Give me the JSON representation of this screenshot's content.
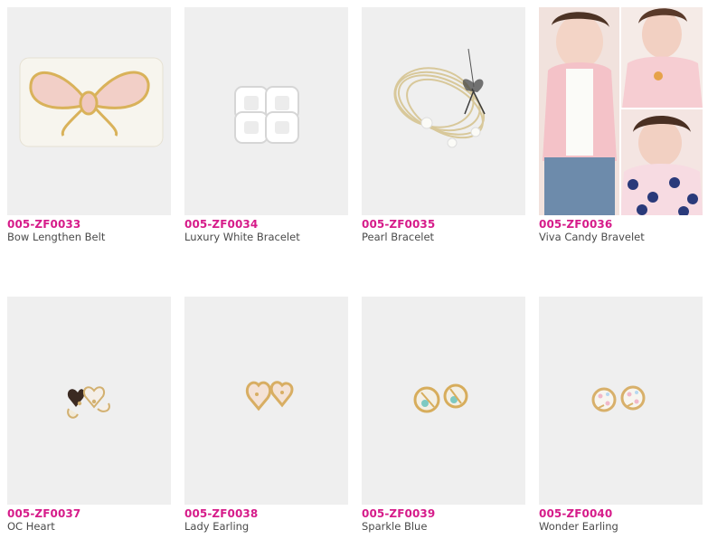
{
  "products": [
    {
      "code": "005-ZF0033",
      "name": "Bow Lengthen Belt",
      "image_icon": "bow-belt-icon"
    },
    {
      "code": "005-ZF0034",
      "name": "Luxury White Bracelet",
      "image_icon": "white-bracelet-icon"
    },
    {
      "code": "005-ZF0035",
      "name": "Pearl Bracelet",
      "image_icon": "pearl-bracelet-icon"
    },
    {
      "code": "005-ZF0036",
      "name": "Viva Candy Bravelet",
      "image_icon": "model-photo-collage-icon"
    },
    {
      "code": "005-ZF0037",
      "name": "OC Heart",
      "image_icon": "heart-earring-icon"
    },
    {
      "code": "005-ZF0038",
      "name": "Lady Earling",
      "image_icon": "lady-earring-icon"
    },
    {
      "code": "005-ZF0039",
      "name": "Sparkle Blue",
      "image_icon": "sparkle-blue-earring-icon"
    },
    {
      "code": "005-ZF0040",
      "name": "Wonder Earling",
      "image_icon": "wonder-earring-icon"
    }
  ],
  "colors": {
    "code_text": "#d61c8a",
    "name_text": "#4a4a4a",
    "thumb_bg": "#efefef"
  }
}
